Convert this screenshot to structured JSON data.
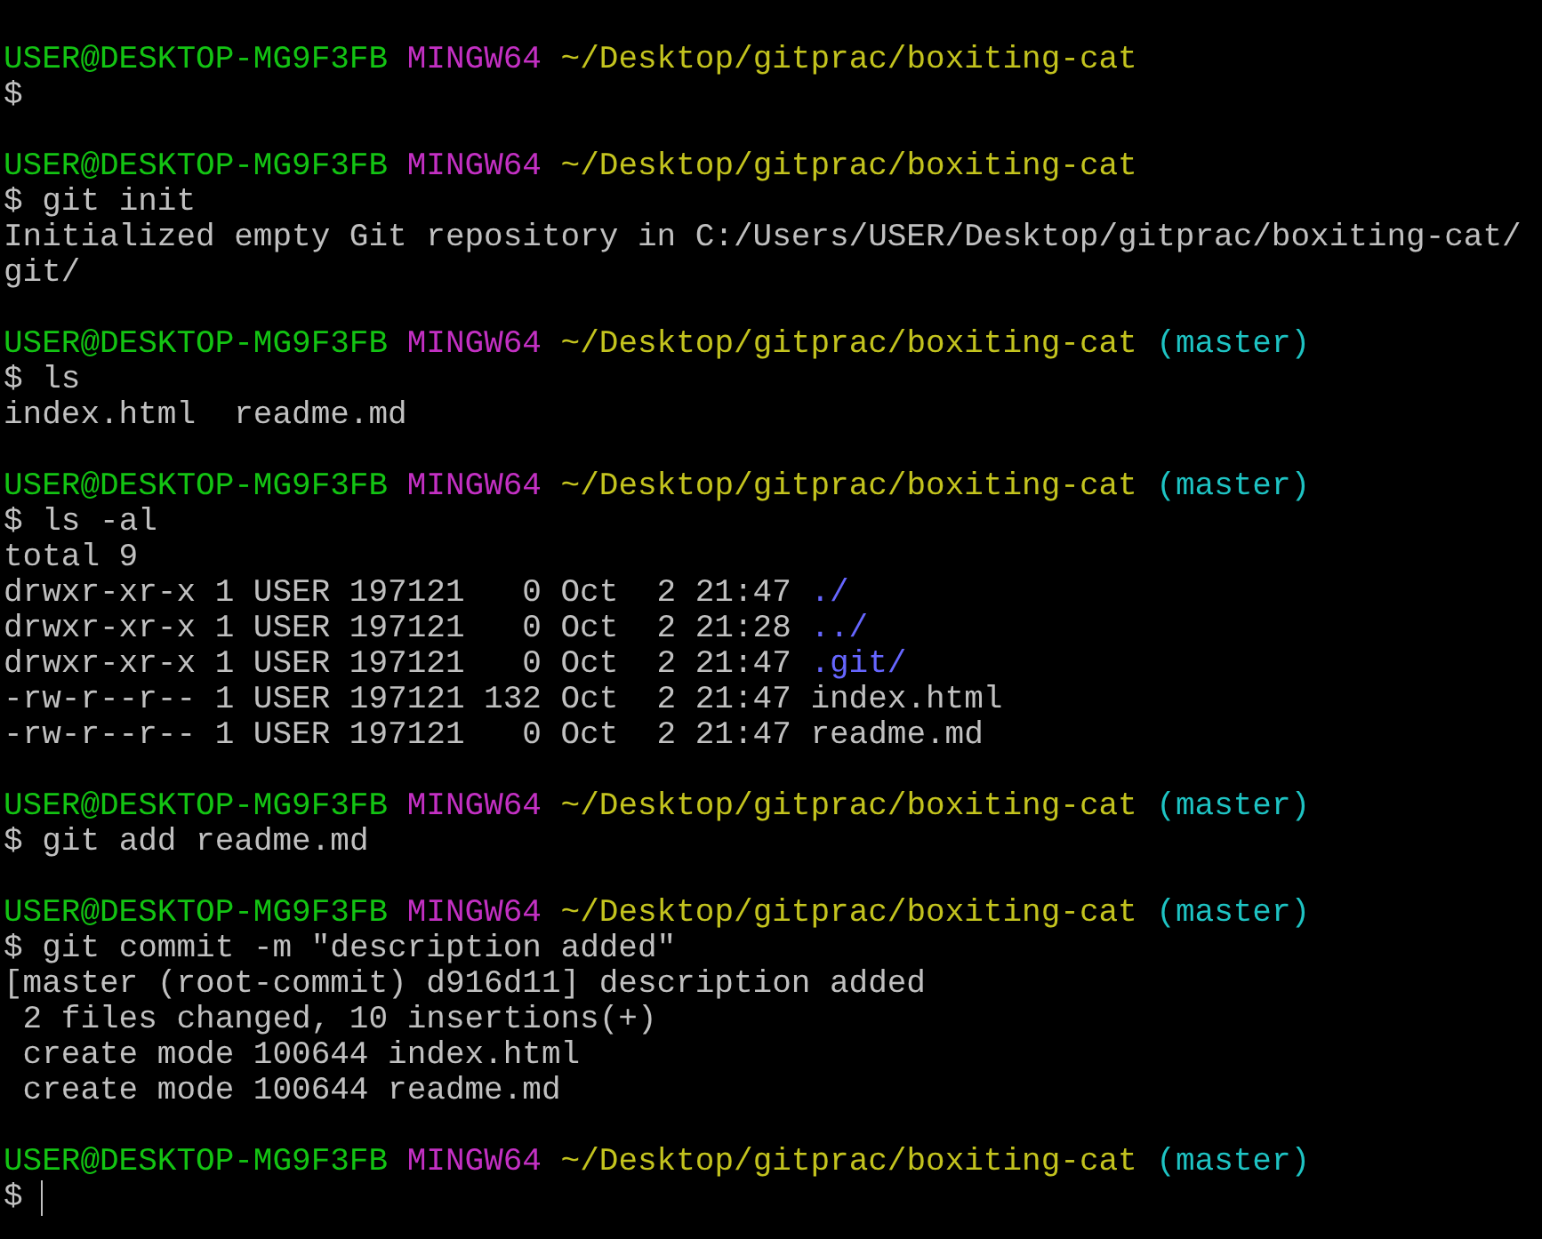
{
  "terminal": {
    "blocks": [
      {
        "prompt": {
          "user": "USER@DESKTOP-MG9F3FB",
          "shell": "MINGW64",
          "path": "~/Desktop/gitprac/boxiting-cat"
        },
        "symbol": "$"
      },
      {
        "prompt": {
          "user": "USER@DESKTOP-MG9F3FB",
          "shell": "MINGW64",
          "path": "~/Desktop/gitprac/boxiting-cat"
        },
        "symbol": "$",
        "command": "git init",
        "output": [
          [
            {
              "kind": "text",
              "text": "Initialized empty Git repository in C:/Users/USER/Desktop/gitprac/boxiting-cat/"
            }
          ],
          [
            {
              "kind": "text",
              "text": "git/"
            }
          ]
        ]
      },
      {
        "prompt": {
          "user": "USER@DESKTOP-MG9F3FB",
          "shell": "MINGW64",
          "path": "~/Desktop/gitprac/boxiting-cat",
          "branch": "(master)"
        },
        "symbol": "$",
        "command": "ls",
        "output": [
          [
            {
              "kind": "text",
              "text": "index.html  readme.md"
            }
          ]
        ]
      },
      {
        "prompt": {
          "user": "USER@DESKTOP-MG9F3FB",
          "shell": "MINGW64",
          "path": "~/Desktop/gitprac/boxiting-cat",
          "branch": "(master)"
        },
        "symbol": "$",
        "command": "ls -al",
        "output": [
          [
            {
              "kind": "text",
              "text": "total 9"
            }
          ],
          [
            {
              "kind": "text",
              "text": "drwxr-xr-x 1 USER 197121   0 Oct  2 21:47"
            },
            {
              "kind": "dir",
              "text": "./"
            }
          ],
          [
            {
              "kind": "text",
              "text": "drwxr-xr-x 1 USER 197121   0 Oct  2 21:28"
            },
            {
              "kind": "dir",
              "text": "../"
            }
          ],
          [
            {
              "kind": "text",
              "text": "drwxr-xr-x 1 USER 197121   0 Oct  2 21:47"
            },
            {
              "kind": "dir",
              "text": ".git/"
            }
          ],
          [
            {
              "kind": "text",
              "text": "-rw-r--r-- 1 USER 197121 132 Oct  2 21:47"
            },
            {
              "kind": "file",
              "text": "index.html"
            }
          ],
          [
            {
              "kind": "text",
              "text": "-rw-r--r-- 1 USER 197121   0 Oct  2 21:47"
            },
            {
              "kind": "file",
              "text": "readme.md"
            }
          ]
        ]
      },
      {
        "prompt": {
          "user": "USER@DESKTOP-MG9F3FB",
          "shell": "MINGW64",
          "path": "~/Desktop/gitprac/boxiting-cat",
          "branch": "(master)"
        },
        "symbol": "$",
        "command": "git add readme.md"
      },
      {
        "prompt": {
          "user": "USER@DESKTOP-MG9F3FB",
          "shell": "MINGW64",
          "path": "~/Desktop/gitprac/boxiting-cat",
          "branch": "(master)"
        },
        "symbol": "$",
        "command": "git commit -m \"description added\"",
        "output": [
          [
            {
              "kind": "text",
              "text": "[master (root-commit) d916d11] description added"
            }
          ],
          [
            {
              "kind": "text",
              "text": " 2 files changed, 10 insertions(+)"
            }
          ],
          [
            {
              "kind": "text",
              "text": " create mode 100644 index.html"
            }
          ],
          [
            {
              "kind": "text",
              "text": " create mode 100644 readme.md"
            }
          ]
        ]
      },
      {
        "prompt": {
          "user": "USER@DESKTOP-MG9F3FB",
          "shell": "MINGW64",
          "path": "~/Desktop/gitprac/boxiting-cat",
          "branch": "(master)"
        },
        "symbol": "$",
        "cursor": true
      }
    ]
  }
}
